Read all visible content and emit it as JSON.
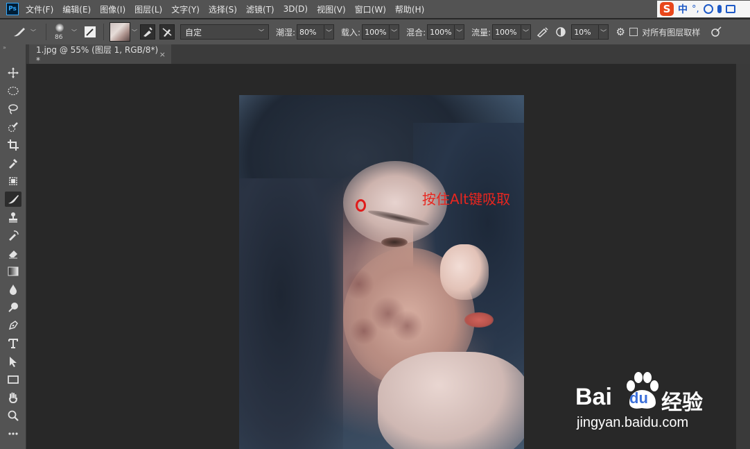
{
  "menubar": {
    "logo": "Ps",
    "items": [
      "文件(F)",
      "编辑(E)",
      "图像(I)",
      "图层(L)",
      "文字(Y)",
      "选择(S)",
      "滤镜(T)",
      "3D(D)",
      "视图(V)",
      "窗口(W)",
      "帮助(H)"
    ],
    "ime": {
      "logo": "S",
      "lang": "中",
      "punct": "°,"
    }
  },
  "options": {
    "brush_size": "86",
    "mode": "自定",
    "wet_label": "潮湿:",
    "wet_value": "80%",
    "load_label": "载入:",
    "load_value": "100%",
    "mix_label": "混合:",
    "mix_value": "100%",
    "flow_label": "流量:",
    "flow_value": "100%",
    "smooth_value": "10%",
    "sample_all_label": "对所有图层取样"
  },
  "document": {
    "tab_title": "1.jpg @ 55% (图层 1, RGB/8*) *",
    "close": "×"
  },
  "annotation": {
    "text": "按住Alt键吸取",
    "color": "#e8261f"
  },
  "watermark": {
    "bai": "Bai",
    "du": "du",
    "jingyan": "经验",
    "url": "jingyan.baidu.com"
  },
  "icons": {
    "tools": [
      "move-icon",
      "marquee-ellipse-icon",
      "lasso-icon",
      "quick-select-icon",
      "crop-icon",
      "eyedropper-icon",
      "frame-icon",
      "mixer-brush-icon",
      "stamp-icon",
      "history-brush-icon",
      "eraser-icon",
      "gradient-icon",
      "blur-drop-icon",
      "dodge-icon",
      "pen-icon",
      "type-icon",
      "path-select-icon",
      "rectangle-icon",
      "hand-icon",
      "zoom-icon",
      "more-icon"
    ]
  }
}
